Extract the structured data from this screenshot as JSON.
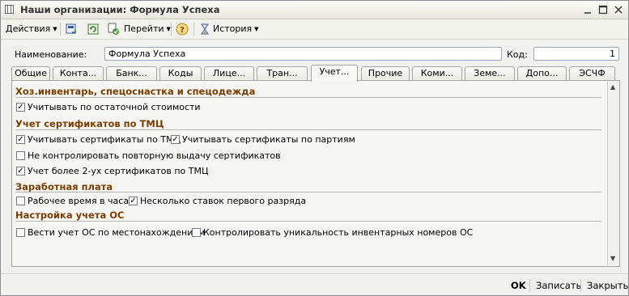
{
  "window": {
    "title": "Наши организации: Формула Успеха"
  },
  "toolbar": {
    "actions_label": "Действия",
    "navigate_label": "Перейти",
    "help_label": "?",
    "history_label": "История"
  },
  "form": {
    "name_label": "Наименование:",
    "name_value": "Формула Успеха",
    "code_label": "Код:",
    "code_value": "1"
  },
  "tabs": [
    {
      "label": "Общие"
    },
    {
      "label": "Конта..."
    },
    {
      "label": "Банк..."
    },
    {
      "label": "Коды"
    },
    {
      "label": "Лице..."
    },
    {
      "label": "Тран..."
    },
    {
      "label": "Учет..."
    },
    {
      "label": "Прочие"
    },
    {
      "label": "Коми..."
    },
    {
      "label": "Земе..."
    },
    {
      "label": "Допо..."
    },
    {
      "label": "ЭСЧФ"
    }
  ],
  "active_tab": "Учет...",
  "sections": {
    "inventory": {
      "title": "Хоз.инвентарь, спецоснастка и спецодежда",
      "residual_value": {
        "label": "Учитывать по остаточной стоимости",
        "checked": true
      }
    },
    "certificates": {
      "title": "Учет сертификатов по ТМЦ",
      "track_by_tmc": {
        "label": "Учитывать сертификаты по ТМЦ",
        "checked": true
      },
      "track_by_batches": {
        "label": "Учитывать сертификаты по партиям",
        "checked": true
      },
      "no_repeat_control": {
        "label": "Не контролировать повторную выдачу сертификатов",
        "checked": false
      },
      "more_than_two": {
        "label": "Учет более 2-ух сертификатов по ТМЦ",
        "checked": true
      }
    },
    "salary": {
      "title": "Заработная плата",
      "hours": {
        "label": "Рабочее время в часах",
        "checked": false
      },
      "multiple_rates": {
        "label": "Несколько ставок первого разряда",
        "checked": true
      }
    },
    "fixed_assets": {
      "title": "Настройка учета ОС",
      "by_location": {
        "label": "Вести учет ОС по местонахождениям",
        "checked": false
      },
      "unique_inventory": {
        "label": "Контролировать уникальность инвентарных номеров ОС",
        "checked": false
      }
    }
  },
  "footer": {
    "ok_label": "OK",
    "save_label": "Записать",
    "close_label": "Закрыть"
  }
}
